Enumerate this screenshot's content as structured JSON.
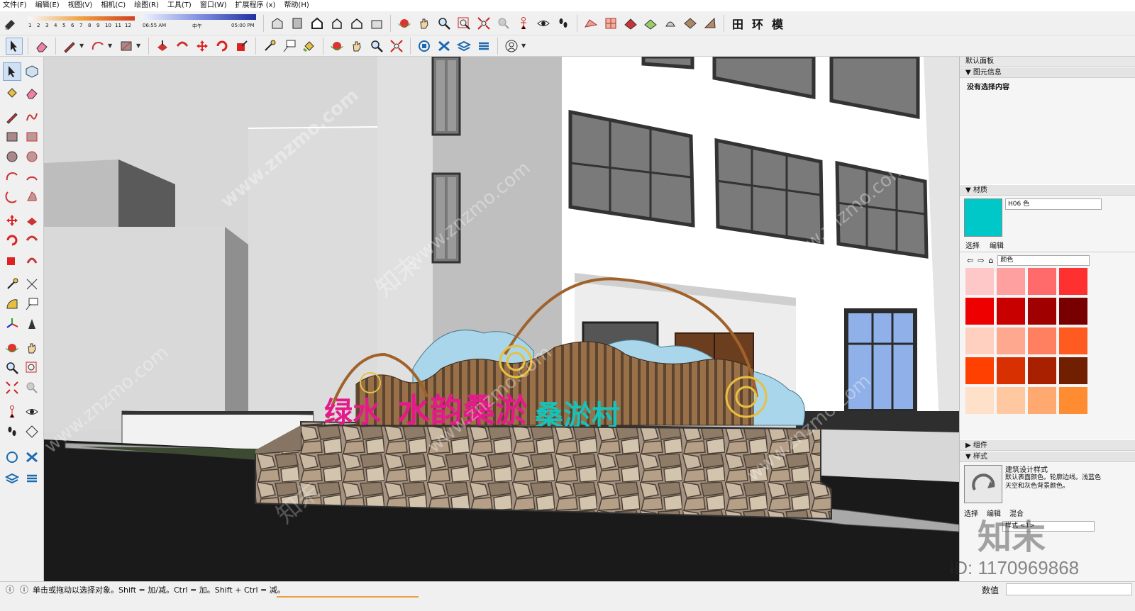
{
  "menu": [
    "文件(F)",
    "编辑(E)",
    "视图(V)",
    "相机(C)",
    "绘图(R)",
    "工具(T)",
    "窗口(W)",
    "扩展程序 (x)",
    "帮助(H)"
  ],
  "shadow": {
    "months": [
      "1",
      "2",
      "3",
      "4",
      "5",
      "6",
      "7",
      "8",
      "9",
      "10",
      "11",
      "12"
    ],
    "time_start": "06:55 AM",
    "time_mid": "中午",
    "time_end": "05:00 PM"
  },
  "toolbar1_text_icons": [
    "田",
    "环",
    "模"
  ],
  "tray": {
    "title": "默认面板",
    "entity_info": "图元信息",
    "no_selection": "没有选择内容",
    "materials": "材质",
    "material_name": "H06 色",
    "material_color": "#00c8c8",
    "tab_select": "选择",
    "tab_edit": "编辑",
    "library": "颜色",
    "swatches": [
      "#ffc8c8",
      "#ffa0a0",
      "#ff6a6a",
      "#ff3030",
      "#ee0000",
      "#c80000",
      "#a00000",
      "#780000",
      "#ffd0c0",
      "#ffa890",
      "#ff8060",
      "#ff5a20",
      "#ff4000",
      "#d83000",
      "#a82000",
      "#702000",
      "#ffe0c8",
      "#ffc8a0",
      "#ffa870",
      "#ff8c30",
      "#ff9a00",
      "#e07800",
      "#b05a00",
      "#803c00"
    ],
    "components": "组件",
    "styles": "样式",
    "style_name": "建筑设计样式",
    "style_desc": "默认表面颜色。轮廓边线。浅蓝色天空和灰色背景颜色。",
    "style_tabs": [
      "选择",
      "编辑",
      "混合"
    ],
    "style_select": "样式 <1>"
  },
  "status": {
    "text": "单击或拖动以选择对象。Shift = 加/减。Ctrl = 加。Shift + Ctrl = 减。",
    "measure_label": "数值"
  },
  "scene": {
    "sign_left": "绿水",
    "sign_mid": "水韵桑淤",
    "sign_right": "桑淤村"
  },
  "watermark": {
    "url": "www.znzmo.com",
    "brand": "知末",
    "id": "ID: 1170969868"
  }
}
